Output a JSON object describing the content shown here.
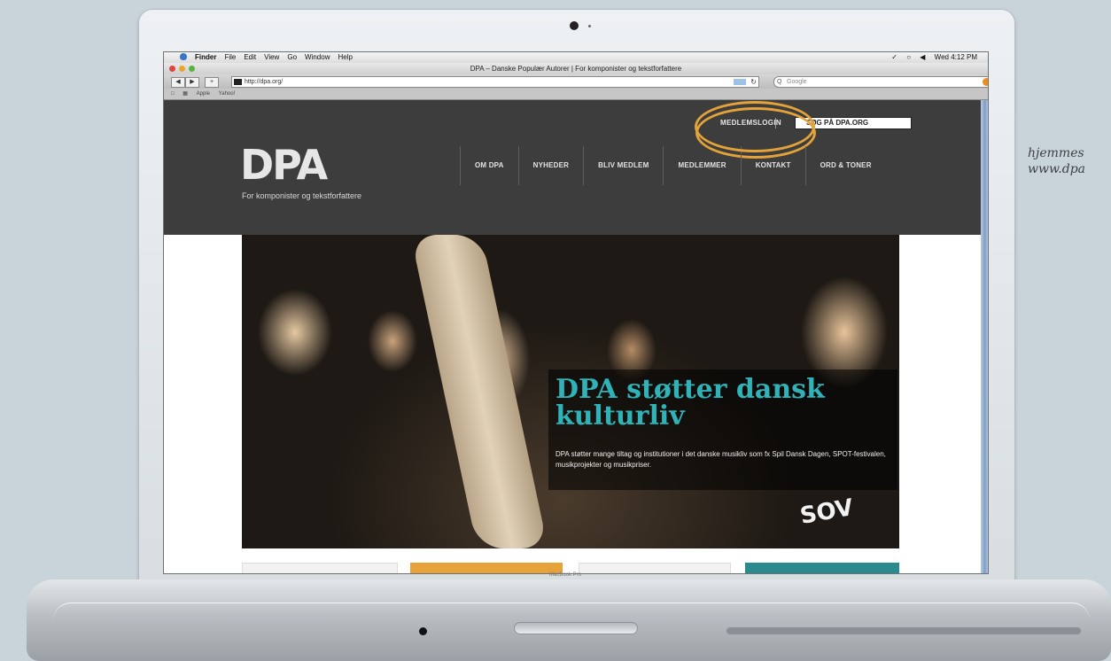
{
  "caption": {
    "line1": "hjemmes",
    "line2": "www.dpa"
  },
  "laptop": {
    "model_label": "MacBook Pro"
  },
  "menubar": {
    "items": [
      "Finder",
      "File",
      "Edit",
      "View",
      "Go",
      "Window",
      "Help"
    ],
    "clock": "Wed 4:12 PM"
  },
  "browser": {
    "window_title": "DPA – Danske Populær Autorer | For komponister og tekstforfattere",
    "url": "http://dpa.org/",
    "search_placeholder": "Google",
    "bookmarks": [
      "Apple",
      "Yahoo!"
    ]
  },
  "site": {
    "top_links": {
      "member_login": "MEDLEMSLOGIN",
      "search": "SØG PÅ DPA.ORG"
    },
    "logo_text": "DPA",
    "tagline": "For komponister og tekstforfattere",
    "nav": [
      "OM DPA",
      "NYHEDER",
      "BLIV MEDLEM",
      "MEDLEMMER",
      "KONTAKT",
      "ORD & TONER"
    ],
    "hero": {
      "headline": "DPA støtter dansk kulturliv",
      "body": "DPA støtter mange tiltag og institutioner i det danske musikliv som fx Spil Dansk Dagen, SPOT-festivalen, musikprojekter og musikpriser.",
      "sign_text": "SOV"
    },
    "tile_colors": [
      "#f2f2f2",
      "#e8a23a",
      "#f2f2f2",
      "#2a8b8e"
    ]
  },
  "colors": {
    "header_bg": "#3d3d3d",
    "highlight": "#e3a23a",
    "headline": "#2fb3b8"
  }
}
